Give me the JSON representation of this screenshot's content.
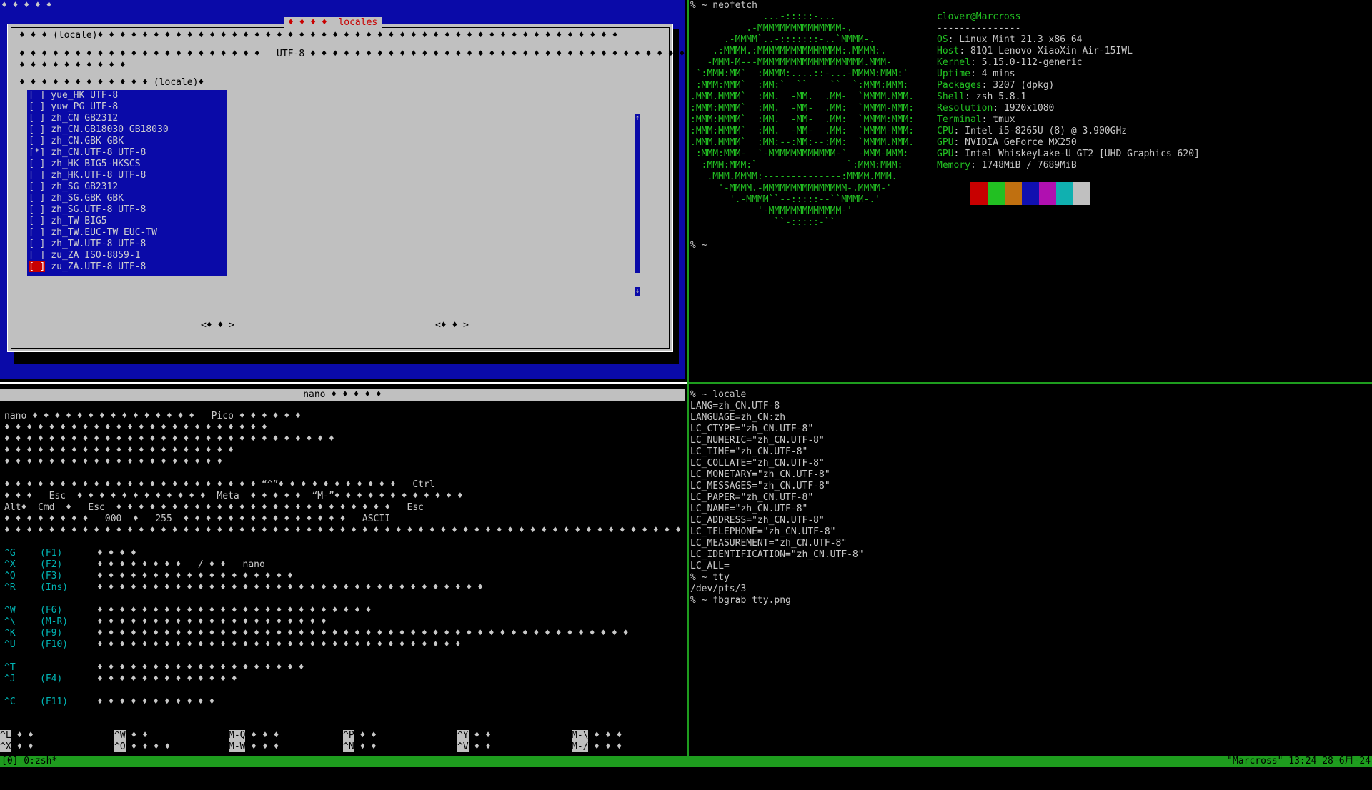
{
  "dialog": {
    "top_marks": "♦ ♦ ♦ ♦ ♦",
    "title_glyphs": "♦ ♦ ♦ ♦",
    "title": "locales",
    "line1": "♦ ♦ ♦ (locale)♦ ♦ ♦ ♦ ♦ ♦ ♦ ♦ ♦ ♦ ♦ ♦ ♦ ♦ ♦ ♦ ♦ ♦ ♦ ♦ ♦ ♦ ♦ ♦ ♦ ♦ ♦ ♦ ♦ ♦ ♦ ♦ ♦ ♦ ♦ ♦ ♦ ♦ ♦ ♦ ♦ ♦ ♦ ♦ ♦ ♦ ♦",
    "line2": "♦ ♦ ♦ ♦ ♦ ♦ ♦ ♦ ♦ ♦ ♦ ♦ ♦ ♦ ♦ ♦ ♦ ♦ ♦ ♦ ♦ ♦   UTF-8 ♦ ♦ ♦ ♦ ♦ ♦ ♦ ♦ ♦ ♦ ♦ ♦ ♦ ♦ ♦ ♦ ♦ ♦ ♦ ♦ ♦ ♦ ♦ ♦ ♦ ♦ ♦ ♦ ♦ ♦ ♦ ♦ ♦ ♦ ♦",
    "line3": "♦ ♦ ♦ ♦ ♦ ♦ ♦ ♦ ♦ ♦",
    "line4": "♦ ♦ ♦ ♦ ♦ ♦ ♦ ♦ ♦ ♦ ♦ ♦ (locale)♦",
    "locales": [
      "[ ] yue_HK UTF-8",
      "[ ] yuw_PG UTF-8",
      "[ ] zh_CN GB2312",
      "[ ] zh_CN.GB18030 GB18030",
      "[ ] zh_CN.GBK GBK",
      "[*] zh_CN.UTF-8 UTF-8",
      "[ ] zh_HK BIG5-HKSCS",
      "[ ] zh_HK.UTF-8 UTF-8",
      "[ ] zh_SG GB2312",
      "[ ] zh_SG.GBK GBK",
      "[ ] zh_SG.UTF-8 UTF-8",
      "[ ] zh_TW BIG5",
      "[ ] zh_TW.EUC-TW EUC-TW",
      "[ ] zh_TW.UTF-8 UTF-8",
      "[ ] zu_ZA ISO-8859-1"
    ],
    "last_locale_box": "[ ]",
    "last_locale_text": " zu_ZA.UTF-8 UTF-8",
    "ok_button": "<♦ ♦ >",
    "cancel_button": "<♦ ♦ >",
    "scroll_up": "↑",
    "scroll_down": "↓"
  },
  "nano": {
    "title": "nano ♦ ♦ ♦ ♦ ♦",
    "lines": [
      "nano ♦ ♦ ♦ ♦ ♦ ♦ ♦ ♦ ♦ ♦ ♦ ♦ ♦ ♦ ♦   Pico ♦ ♦ ♦ ♦ ♦ ♦",
      "♦ ♦ ♦ ♦ ♦ ♦ ♦ ♦ ♦ ♦ ♦ ♦ ♦ ♦ ♦ ♦ ♦ ♦ ♦ ♦ ♦ ♦ ♦ ♦",
      "♦ ♦ ♦ ♦ ♦ ♦ ♦ ♦ ♦ ♦ ♦ ♦ ♦ ♦ ♦ ♦ ♦ ♦ ♦ ♦ ♦ ♦ ♦ ♦ ♦ ♦ ♦ ♦ ♦ ♦",
      "♦ ♦ ♦ ♦ ♦ ♦ ♦ ♦ ♦ ♦ ♦ ♦ ♦ ♦ ♦ ♦ ♦ ♦ ♦ ♦ ♦",
      "♦ ♦ ♦ ♦ ♦ ♦ ♦ ♦ ♦ ♦ ♦ ♦ ♦ ♦ ♦ ♦ ♦ ♦ ♦ ♦",
      "",
      "♦ ♦ ♦ ♦ ♦ ♦ ♦ ♦ ♦ ♦ ♦ ♦ ♦ ♦ ♦ ♦ ♦ ♦ ♦ ♦ ♦ ♦ ♦ “^”♦ ♦ ♦ ♦ ♦ ♦ ♦ ♦ ♦ ♦ ♦   Ctrl",
      "♦ ♦ ♦   Esc  ♦ ♦ ♦ ♦ ♦ ♦ ♦ ♦ ♦ ♦ ♦ ♦  Meta  ♦ ♦ ♦ ♦ ♦  “M-”♦ ♦ ♦ ♦ ♦ ♦ ♦ ♦ ♦ ♦ ♦ ♦",
      "Alt♦  Cmd  ♦   Esc  ♦ ♦ ♦ ♦ ♦ ♦ ♦ ♦ ♦ ♦ ♦ ♦ ♦ ♦ ♦ ♦ ♦ ♦ ♦ ♦ ♦ ♦ ♦ ♦ ♦   Esc",
      "♦ ♦ ♦ ♦ ♦ ♦ ♦ ♦   000  ♦   255  ♦ ♦ ♦ ♦ ♦ ♦ ♦ ♦ ♦ ♦ ♦ ♦ ♦ ♦ ♦   ASCII",
      "♦ ♦ ♦ ♦ ♦ ♦ ♦ ♦ ♦ ♦ ♦ ♦ ♦ ♦ ♦ ♦ ♦ ♦ ♦ ♦ ♦ ♦ ♦ ♦ ♦ ♦ ♦ ♦ ♦ ♦ ♦ ♦ ♦ ♦ ♦ ♦ ♦ ♦ ♦ ♦ ♦ ♦ ♦ ♦ ♦ ♦ ♦ ♦ ♦ ♦ ♦ ♦ ♦ ♦ ♦ ♦ ♦ ♦ ♦ ♦ ♦ ♦ ♦ ♦"
    ],
    "keys": [
      {
        "key": "^G",
        "fk": "(F1)",
        "desc": "♦ ♦ ♦ ♦"
      },
      {
        "key": "^X",
        "fk": "(F2)",
        "desc": "♦ ♦ ♦ ♦ ♦ ♦ ♦ ♦   / ♦ ♦   nano"
      },
      {
        "key": "^O",
        "fk": "(F3)",
        "desc": "♦ ♦ ♦ ♦ ♦ ♦ ♦ ♦ ♦ ♦ ♦ ♦ ♦ ♦ ♦ ♦ ♦ ♦"
      },
      {
        "key": "^R",
        "fk": "(Ins)",
        "desc": "♦ ♦ ♦ ♦ ♦ ♦ ♦ ♦ ♦ ♦ ♦ ♦ ♦ ♦ ♦ ♦ ♦ ♦ ♦ ♦ ♦ ♦ ♦ ♦ ♦ ♦ ♦ ♦ ♦ ♦ ♦ ♦ ♦ ♦ ♦"
      },
      {
        "key": "",
        "fk": "",
        "desc": ""
      },
      {
        "key": "^W",
        "fk": "(F6)",
        "desc": "♦ ♦ ♦ ♦ ♦ ♦ ♦ ♦ ♦ ♦ ♦ ♦ ♦ ♦ ♦ ♦ ♦ ♦ ♦ ♦ ♦ ♦ ♦ ♦ ♦"
      },
      {
        "key": "^\\",
        "fk": "(M-R)",
        "desc": "♦ ♦ ♦ ♦ ♦ ♦ ♦ ♦ ♦ ♦ ♦ ♦ ♦ ♦ ♦ ♦ ♦ ♦ ♦ ♦ ♦"
      },
      {
        "key": "^K",
        "fk": "(F9)",
        "desc": "♦ ♦ ♦ ♦ ♦ ♦ ♦ ♦ ♦ ♦ ♦ ♦ ♦ ♦ ♦ ♦ ♦ ♦ ♦ ♦ ♦ ♦ ♦ ♦ ♦ ♦ ♦ ♦ ♦ ♦ ♦ ♦ ♦ ♦ ♦ ♦ ♦ ♦ ♦ ♦ ♦ ♦ ♦ ♦ ♦ ♦ ♦ ♦"
      },
      {
        "key": "^U",
        "fk": "(F10)",
        "desc": "♦ ♦ ♦ ♦ ♦ ♦ ♦ ♦ ♦ ♦ ♦ ♦ ♦ ♦ ♦ ♦ ♦ ♦ ♦ ♦ ♦ ♦ ♦ ♦ ♦ ♦ ♦ ♦ ♦ ♦ ♦ ♦ ♦"
      },
      {
        "key": "",
        "fk": "",
        "desc": ""
      },
      {
        "key": "^T",
        "fk": "",
        "desc": "♦ ♦ ♦ ♦ ♦ ♦ ♦ ♦ ♦ ♦ ♦ ♦ ♦ ♦ ♦ ♦ ♦ ♦ ♦"
      },
      {
        "key": "^J",
        "fk": "(F4)",
        "desc": "♦ ♦ ♦ ♦ ♦ ♦ ♦ ♦ ♦ ♦ ♦ ♦ ♦"
      },
      {
        "key": "",
        "fk": "",
        "desc": ""
      },
      {
        "key": "^C",
        "fk": "(F11)",
        "desc": "♦ ♦ ♦ ♦ ♦ ♦ ♦ ♦ ♦ ♦ ♦"
      }
    ],
    "shortcuts_row1": [
      {
        "k": "^L",
        "t": " ♦ ♦"
      },
      {
        "k": "^W",
        "t": " ♦ ♦"
      },
      {
        "k": "M-Q",
        "t": " ♦ ♦ ♦"
      },
      {
        "k": "^P",
        "t": " ♦ ♦"
      },
      {
        "k": "^Y",
        "t": " ♦ ♦"
      },
      {
        "k": "M-\\",
        "t": " ♦ ♦ ♦"
      }
    ],
    "shortcuts_row2": [
      {
        "k": "^X",
        "t": " ♦ ♦"
      },
      {
        "k": "^O",
        "t": " ♦ ♦ ♦ ♦"
      },
      {
        "k": "M-W",
        "t": " ♦ ♦ ♦"
      },
      {
        "k": "^N",
        "t": " ♦ ♦"
      },
      {
        "k": "^V",
        "t": " ♦ ♦"
      },
      {
        "k": "M-/",
        "t": " ♦ ♦ ♦"
      }
    ]
  },
  "neofetch": {
    "prompt": "% ~ neofetch",
    "prompt2": "% ~",
    "logo": [
      "             ...-:::::-...",
      "          .-MMMMMMMMMMMMMMM-.",
      "      .-MMMM`..-:::::::-..`MMMM-.",
      "    .:MMMM.:MMMMMMMMMMMMMMM:.MMMM:.",
      "   -MMM-M---MMMMMMMMMMMMMMMMMMM.MMM-",
      " `:MMM:MM`  :MMMM:....::-...-MMMM:MMM:`",
      " :MMM:MMM`  :MM:`  ``    ``  `:MMM:MMM:",
      ".MMM.MMMM`  :MM.  -MM.  .MM-  `MMMM.MMM.",
      ":MMM:MMMM`  :MM.  -MM-  .MM:  `MMMM-MMM:",
      ":MMM:MMMM`  :MM.  -MM-  .MM:  `MMMM:MMM:",
      ":MMM:MMMM`  :MM.  -MM-  .MM:  `MMMM-MMM:",
      ".MMM.MMMM`  :MM:--:MM:--:MM:  `MMMM.MMM.",
      " :MMM:MMM-  `-MMMMMMMMMMMM-`  -MMM-MMM:",
      "  :MMM:MMM:`                `:MMM:MMM:",
      "   .MMM.MMMM:--------------:MMMM.MMM.",
      "     '-MMMM.-MMMMMMMMMMMMMMM-.MMMM-'",
      "       '.-MMMM``--:::::--``MMMM-.'",
      "            '-MMMMMMMMMMMMM-'",
      "               ``-:::::-``"
    ],
    "user": "clover@Marcross",
    "sep": "---------------",
    "info": [
      {
        "label": "OS",
        "value": " Linux Mint 21.3 x86_64"
      },
      {
        "label": "Host",
        "value": " 81Q1 Lenovo XiaoXin Air-15IWL"
      },
      {
        "label": "Kernel",
        "value": " 5.15.0-112-generic"
      },
      {
        "label": "Uptime",
        "value": " 4 mins"
      },
      {
        "label": "Packages",
        "value": " 3207 (dpkg)"
      },
      {
        "label": "Shell",
        "value": " zsh 5.8.1"
      },
      {
        "label": "Resolution",
        "value": " 1920x1080"
      },
      {
        "label": "Terminal",
        "value": " tmux"
      },
      {
        "label": "CPU",
        "value": " Intel i5-8265U (8) @ 3.900GHz"
      },
      {
        "label": "GPU",
        "value": " NVIDIA GeForce MX250"
      },
      {
        "label": "GPU",
        "value": " Intel WhiskeyLake-U GT2 [UHD Graphics 620]"
      },
      {
        "label": "Memory",
        "value": " 1748MiB / 7689MiB"
      }
    ],
    "swatch_colors": [
      "#000000",
      "#c80000",
      "#22c022",
      "#c07010",
      "#1010b0",
      "#b010b0",
      "#10b0b0",
      "#c0c0c0"
    ]
  },
  "locale_pane": {
    "lines": [
      "% ~ locale",
      "LANG=zh_CN.UTF-8",
      "LANGUAGE=zh_CN:zh",
      "LC_CTYPE=\"zh_CN.UTF-8\"",
      "LC_NUMERIC=\"zh_CN.UTF-8\"",
      "LC_TIME=\"zh_CN.UTF-8\"",
      "LC_COLLATE=\"zh_CN.UTF-8\"",
      "LC_MONETARY=\"zh_CN.UTF-8\"",
      "LC_MESSAGES=\"zh_CN.UTF-8\"",
      "LC_PAPER=\"zh_CN.UTF-8\"",
      "LC_NAME=\"zh_CN.UTF-8\"",
      "LC_ADDRESS=\"zh_CN.UTF-8\"",
      "LC_TELEPHONE=\"zh_CN.UTF-8\"",
      "LC_MEASUREMENT=\"zh_CN.UTF-8\"",
      "LC_IDENTIFICATION=\"zh_CN.UTF-8\"",
      "LC_ALL=",
      "% ~ tty",
      "/dev/pts/3",
      "% ~ fbgrab tty.png"
    ]
  },
  "statusbar": {
    "left": "[0] 0:zsh*",
    "right": "\"Marcross\" 13:24 28-6月-24"
  }
}
